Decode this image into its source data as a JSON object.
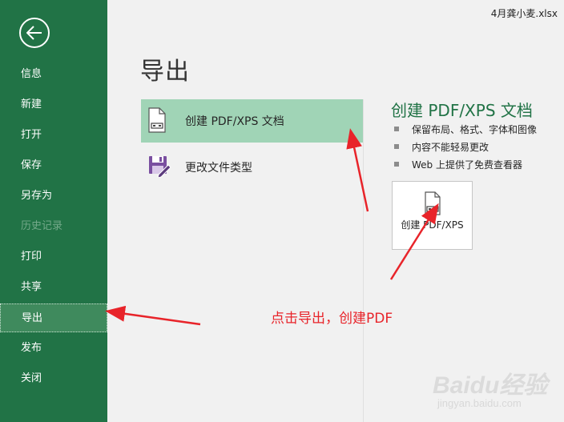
{
  "file": {
    "name": "4月龚小麦.xlsx"
  },
  "sidebar": {
    "items": [
      {
        "label": "信息",
        "state": "normal"
      },
      {
        "label": "新建",
        "state": "normal"
      },
      {
        "label": "打开",
        "state": "normal"
      },
      {
        "label": "保存",
        "state": "normal"
      },
      {
        "label": "另存为",
        "state": "normal"
      },
      {
        "label": "历史记录",
        "state": "disabled"
      },
      {
        "label": "打印",
        "state": "normal"
      },
      {
        "label": "共享",
        "state": "normal"
      },
      {
        "label": "导出",
        "state": "selected"
      },
      {
        "label": "发布",
        "state": "normal"
      },
      {
        "label": "关闭",
        "state": "normal"
      }
    ]
  },
  "main": {
    "title": "导出",
    "options": [
      {
        "label": "创建 PDF/XPS 文档",
        "selected": true
      },
      {
        "label": "更改文件类型",
        "selected": false
      }
    ]
  },
  "detail": {
    "title": "创建 PDF/XPS 文档",
    "bullets": [
      "保留布局、格式、字体和图像",
      "内容不能轻易更改",
      "Web 上提供了免费查看器"
    ],
    "button_label": "创建 PDF/XPS"
  },
  "annotation": {
    "text": "点击导出，创建PDF"
  },
  "watermark": {
    "brand": "Baidu经验",
    "sub": "jingyan.baidu.com"
  },
  "colors": {
    "sidebar": "#217346",
    "accent": "#217346",
    "selected_option": "#a0d4b6",
    "annotation": "#e8242a"
  }
}
